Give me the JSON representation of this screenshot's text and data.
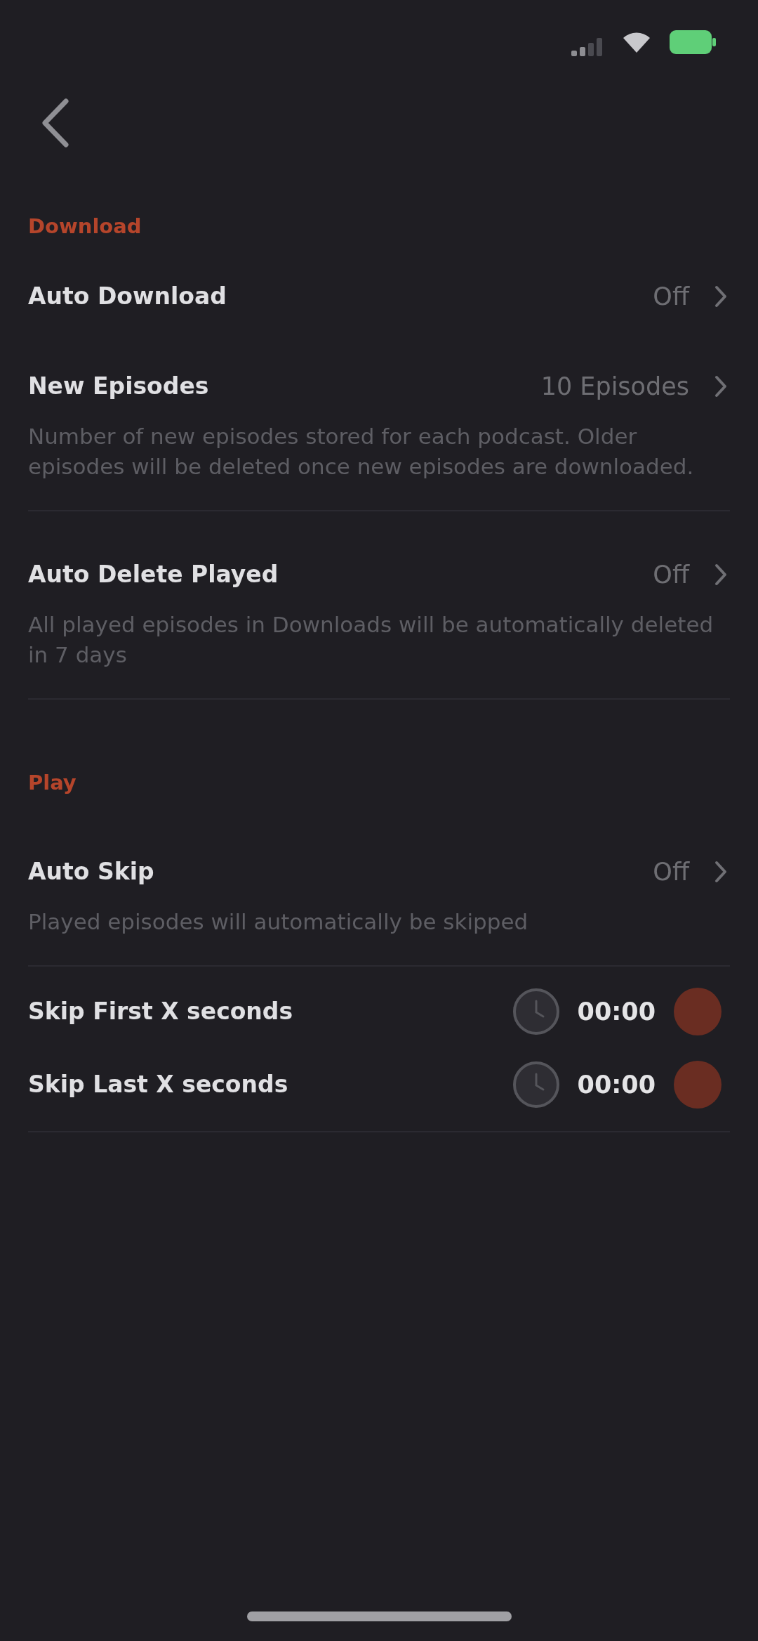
{
  "sections": [
    {
      "title": "Download",
      "rows": [
        {
          "kind": "link",
          "label": "Auto Download",
          "value": "Off"
        },
        {
          "kind": "link",
          "label": "New Episodes",
          "value": "10 Episodes",
          "description": "Number of new episodes stored for each podcast. Older episodes will be deleted once new episodes are downloaded."
        },
        {
          "kind": "link",
          "label": "Auto Delete Played",
          "value": "Off",
          "description": "All played episodes in Downloads will be automatically deleted in 7 days"
        }
      ]
    },
    {
      "title": "Play",
      "rows": [
        {
          "kind": "link",
          "label": "Auto Skip",
          "value": "Off",
          "description": "Played episodes will automatically be skipped"
        },
        {
          "kind": "time",
          "label": "Skip First X seconds",
          "time": "00:00"
        },
        {
          "kind": "time",
          "label": "Skip Last X seconds",
          "time": "00:00"
        }
      ]
    }
  ]
}
